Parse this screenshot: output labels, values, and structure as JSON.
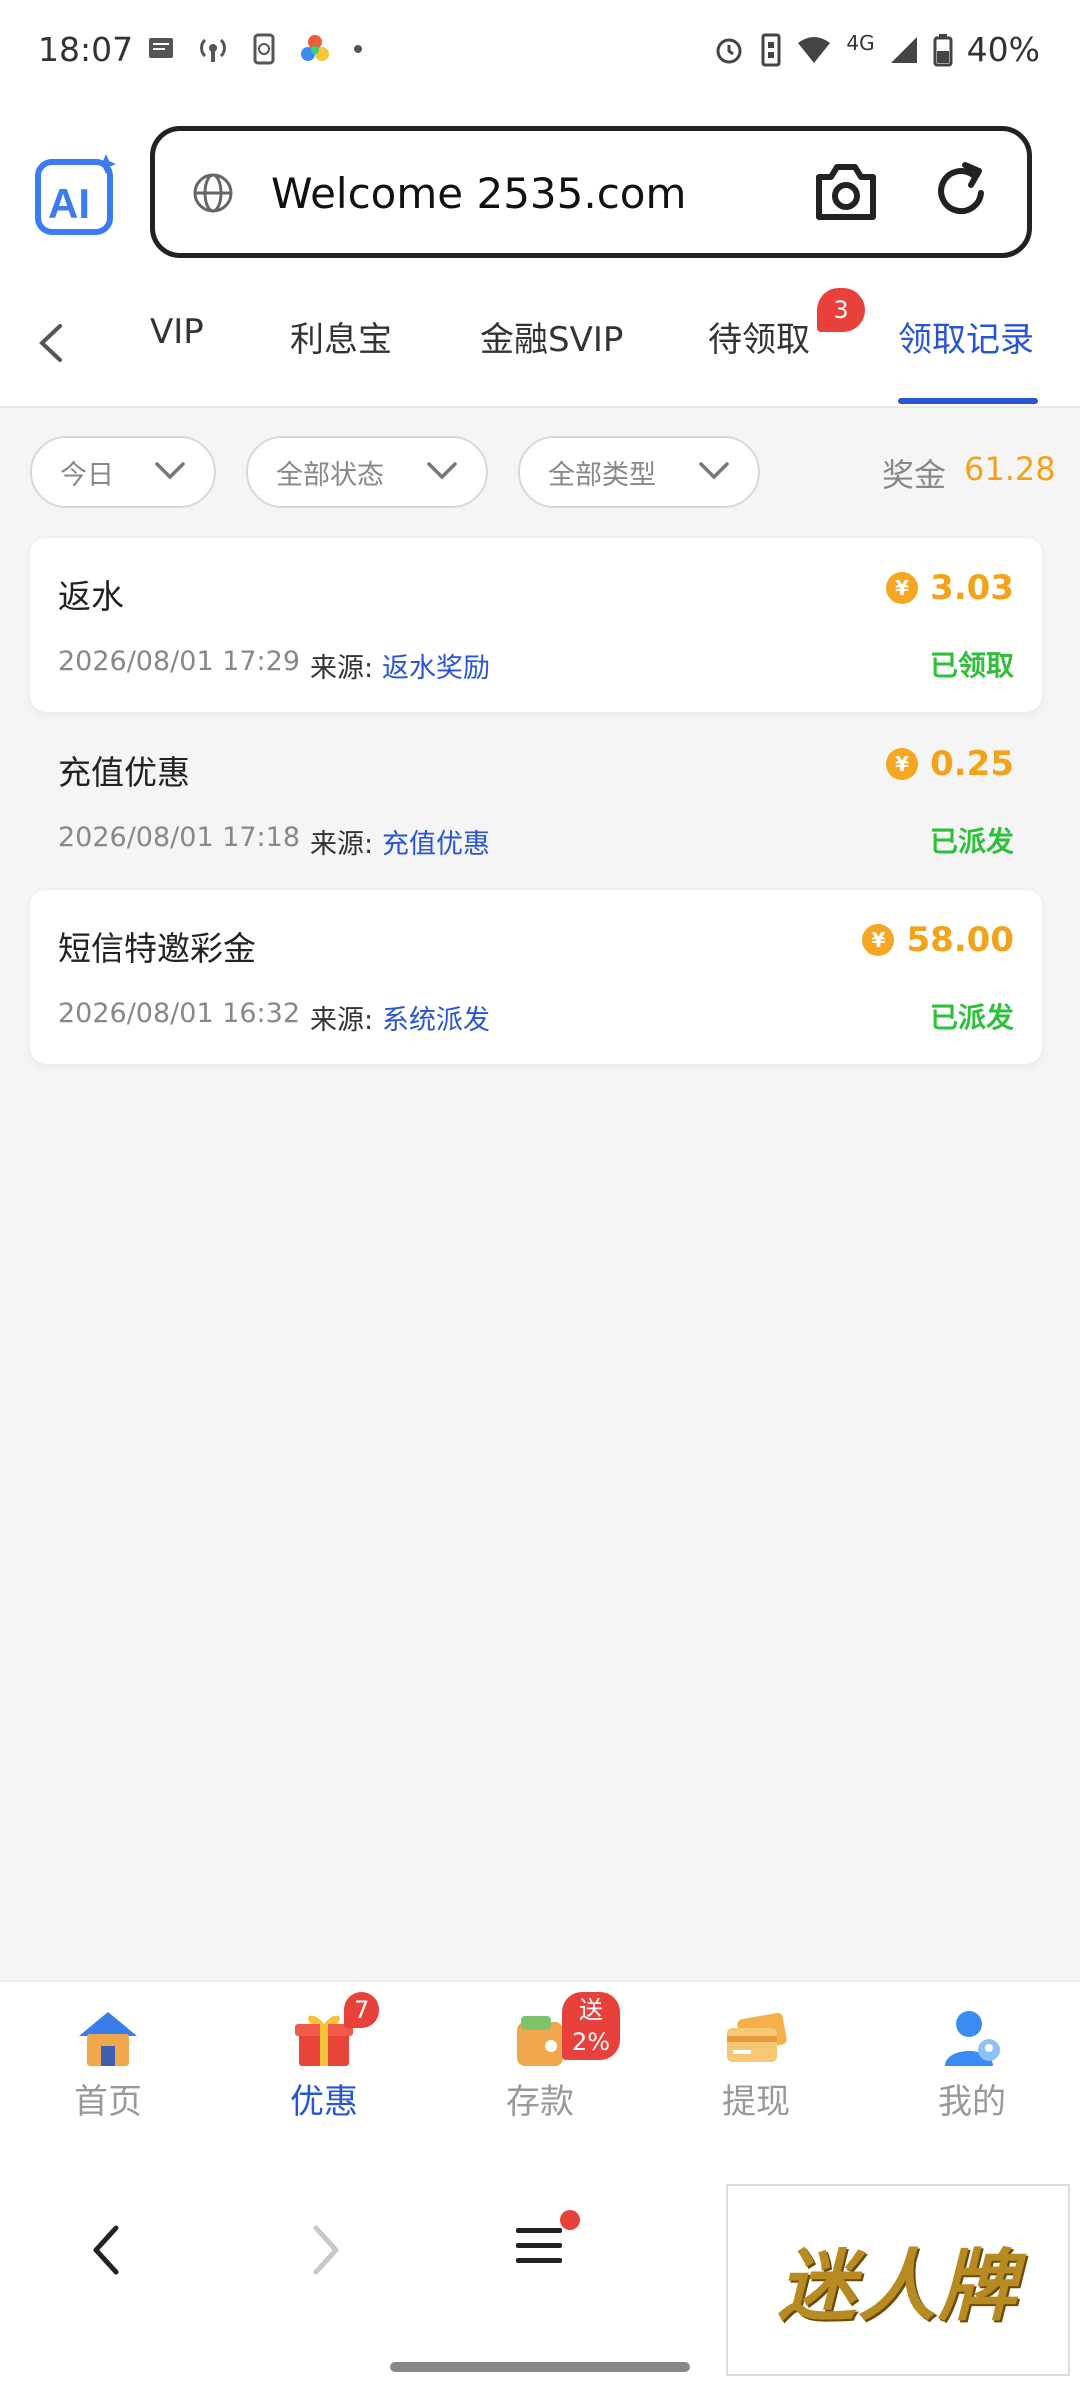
{
  "status_bar": {
    "time": "18:07",
    "network": "4G",
    "battery": "40%"
  },
  "browser": {
    "url": "Welcome 2535.com"
  },
  "tabs": [
    {
      "label": "VIP"
    },
    {
      "label": "利息宝"
    },
    {
      "label": "金融SVIP"
    },
    {
      "label": "待领取",
      "badge": "3"
    },
    {
      "label": "领取记录",
      "active": true
    }
  ],
  "filters": {
    "date": "今日",
    "status": "全部状态",
    "type": "全部类型"
  },
  "bonus": {
    "label": "奖金",
    "value": "61.28"
  },
  "records": [
    {
      "title": "返水",
      "date": "2026/08/01 17:29",
      "source_label": "来源:",
      "source": "返水奖励",
      "amount": "3.03",
      "status": "已领取"
    },
    {
      "title": "充值优惠",
      "date": "2026/08/01 17:18",
      "source_label": "来源:",
      "source": "充值优惠",
      "amount": "0.25",
      "status": "已派发"
    },
    {
      "title": "短信特邀彩金",
      "date": "2026/08/01 16:32",
      "source_label": "来源:",
      "source": "系统派发",
      "amount": "58.00",
      "status": "已派发"
    }
  ],
  "bottom_nav": [
    {
      "label": "首页",
      "icon": "home-icon"
    },
    {
      "label": "优惠",
      "icon": "gift-icon",
      "badge": "7",
      "active": true
    },
    {
      "label": "存款",
      "icon": "wallet-icon",
      "badge": "送2%"
    },
    {
      "label": "提现",
      "icon": "card-icon"
    },
    {
      "label": "我的",
      "icon": "user-icon"
    }
  ],
  "ad": {
    "text": "迷人牌"
  },
  "colors": {
    "accent": "#2755d6",
    "gold": "#f2a31b",
    "green": "#2fbf3a",
    "badge": "#e8403a"
  }
}
